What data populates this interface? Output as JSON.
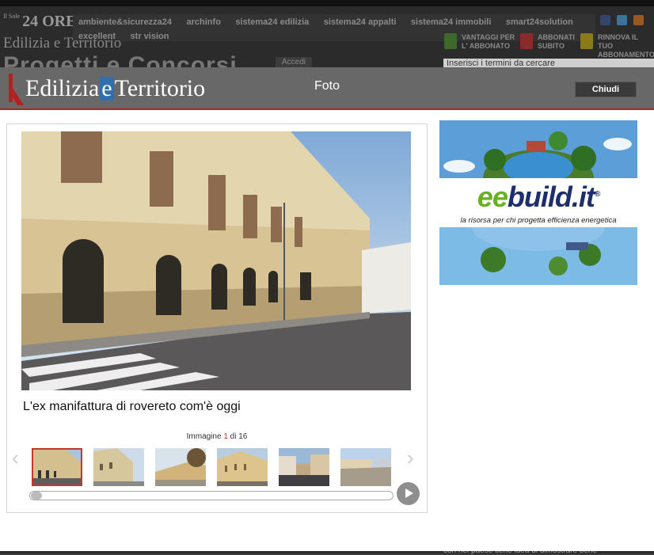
{
  "background_site": {
    "brand_small": "Il Sole",
    "brand_big": "24 ORE",
    "nav": [
      "ambiente&sicurezza24",
      "archinfo",
      "sistema24 edilizia",
      "sistema24 appalti",
      "sistema24 immobili",
      "smart24solution",
      "excellent",
      "str vision"
    ],
    "site_logo": "Edilizia e Territorio",
    "promos": [
      {
        "line1": "VANTAGGI PER",
        "line2": "L' ABBONATO"
      },
      {
        "line1": "ABBONATI",
        "line2": "SUBITO"
      },
      {
        "line1": "RINNOVA IL TUO",
        "line2": "ABBONAMENTO"
      }
    ],
    "section_title": "Progetti e Concorsi",
    "login_label": "Accedi",
    "search_placeholder": "Inserisci i termini da cercare",
    "footer_fragment": "con nel paese tiene idea di dimostrare bene"
  },
  "modal": {
    "logo_left": "Edilizia",
    "logo_e": "e",
    "logo_right": "Territorio",
    "title": "Foto",
    "close_label": "Chiudi"
  },
  "gallery": {
    "caption": "L'ex manifattura di rovereto com'è oggi",
    "counter_prefix": "Immagine",
    "counter_current": "1",
    "counter_sep": "di",
    "counter_total": "16",
    "prev_icon": "‹",
    "next_icon": "›",
    "thumb_count_visible": 6,
    "selected_thumb_index": 0
  },
  "ad": {
    "brand_ee": "ee",
    "brand_rest": "build.it",
    "reg": "®",
    "tagline": "la risorsa per chi progetta efficienza energetica"
  },
  "colors": {
    "accent_red": "#c0392b",
    "header_gray": "#686868",
    "ad_blue": "#1e2e6b",
    "ad_green": "#6ab023"
  }
}
